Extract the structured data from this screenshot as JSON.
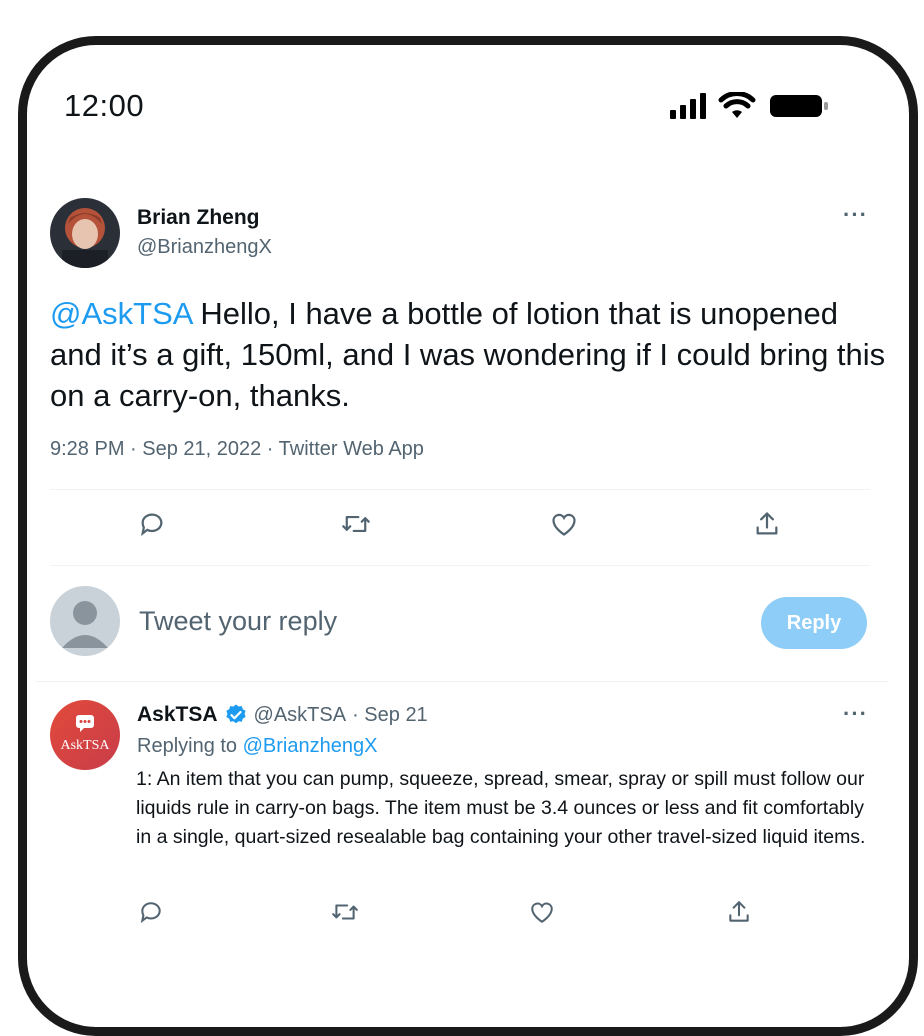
{
  "status_bar": {
    "time": "12:00"
  },
  "tweet": {
    "author_name": "Brian Zheng",
    "author_handle": "@BrianzhengX",
    "mention": "@AskTSA",
    "text": " Hello, I have a bottle of lotion that is unopened and it’s a gift, 150ml,  and I was wondering if I could bring this on a carry-on, thanks.",
    "timestamp": "9:28 PM · Sep 21, 2022 · Twitter Web App",
    "actions": [
      "reply-icon",
      "retweet-icon",
      "like-icon",
      "share-icon"
    ]
  },
  "composer": {
    "placeholder": "Tweet your reply",
    "reply_label": "Reply"
  },
  "reply": {
    "author_name": "AskTSA",
    "avatar_text": "AskTSA",
    "author_handle": "@AskTSA",
    "date": "· Sep 21",
    "replying_prefix": "Replying to ",
    "replying_to": "@BrianzhengX",
    "text": "1: An item that you can pump, squeeze, spread, smear, spray or spill must follow our liquids rule in carry-on bags. The item must be 3.4 ounces or less and fit comfortably in a single, quart-sized resealable bag containing your other travel-sized liquid items."
  },
  "colors": {
    "accent": "#1d9bf0",
    "reply_button": "#8ecdf8",
    "muted": "#536471",
    "tsa_avatar": "#d8423f"
  }
}
